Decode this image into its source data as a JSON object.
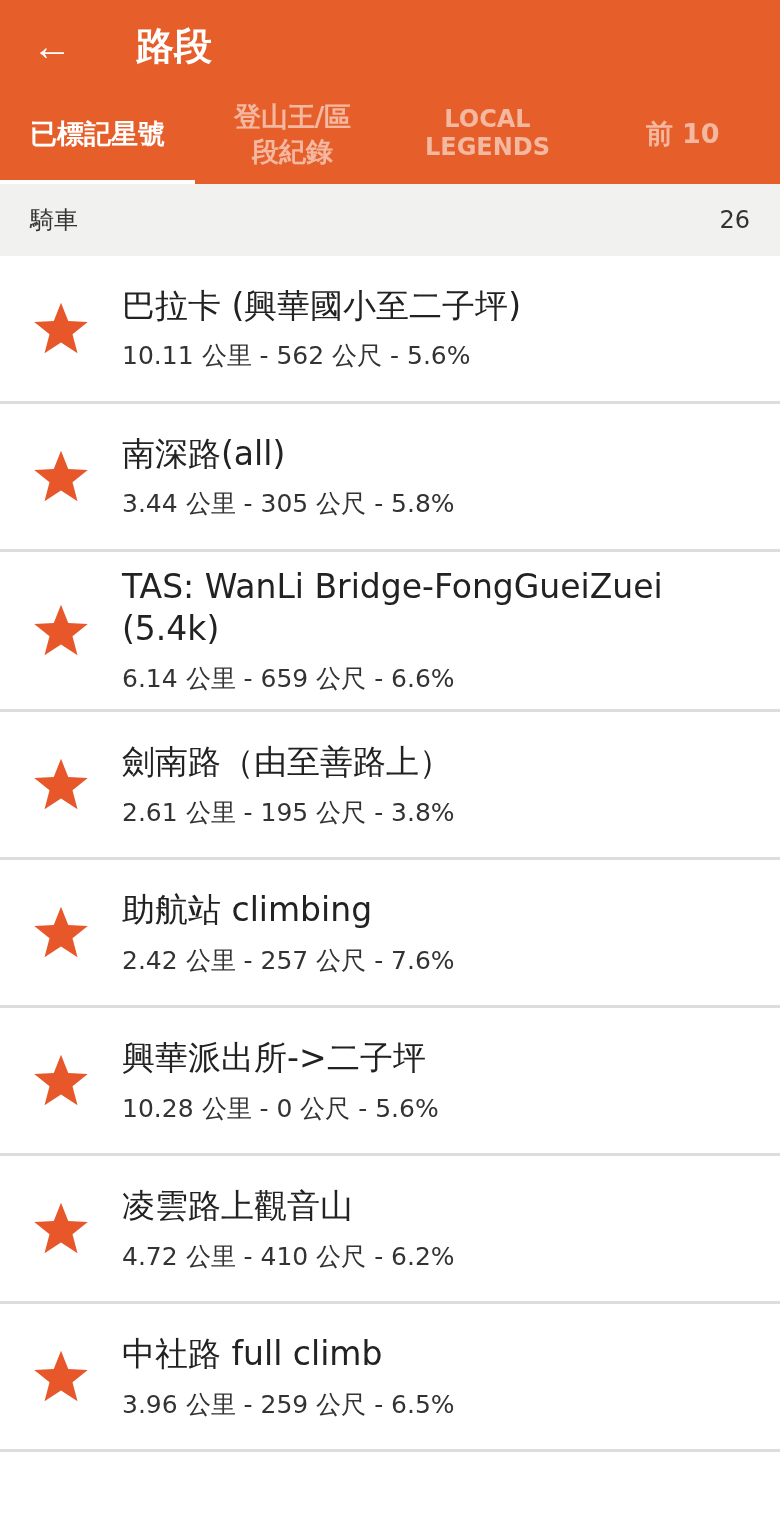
{
  "app_bar": {
    "back": "←",
    "title": "路段"
  },
  "tabs": [
    {
      "label": "已標記星號",
      "selected": true
    },
    {
      "label": "登山王/區段紀錄",
      "selected": false
    },
    {
      "label": "LOCAL LEGENDS",
      "selected": false
    },
    {
      "label": "前 10",
      "selected": false
    }
  ],
  "section": {
    "title": "騎車",
    "count": "26"
  },
  "segments": [
    {
      "name": "巴拉卡 (興華國小至二子坪)",
      "stats": "10.11 公里 - 562 公尺 - 5.6%",
      "starred": true
    },
    {
      "name": "南深路(all)",
      "stats": "3.44 公里 - 305 公尺 - 5.8%",
      "starred": true
    },
    {
      "name": "TAS: WanLi Bridge-FongGueiZuei (5.4k)",
      "stats": "6.14 公里 - 659 公尺 - 6.6%",
      "starred": true
    },
    {
      "name": "劍南路（由至善路上）",
      "stats": "2.61 公里 - 195 公尺 - 3.8%",
      "starred": true
    },
    {
      "name": "助航站 climbing",
      "stats": "2.42 公里 - 257 公尺 - 7.6%",
      "starred": true
    },
    {
      "name": "興華派出所->二子坪",
      "stats": "10.28 公里 - 0 公尺 - 5.6%",
      "starred": true
    },
    {
      "name": "凌雲路上觀音山",
      "stats": "4.72 公里 - 410 公尺 - 6.2%",
      "starred": true
    },
    {
      "name": "中社路 full climb",
      "stats": "3.96 公里 - 259 公尺 - 6.5%",
      "starred": true
    }
  ]
}
